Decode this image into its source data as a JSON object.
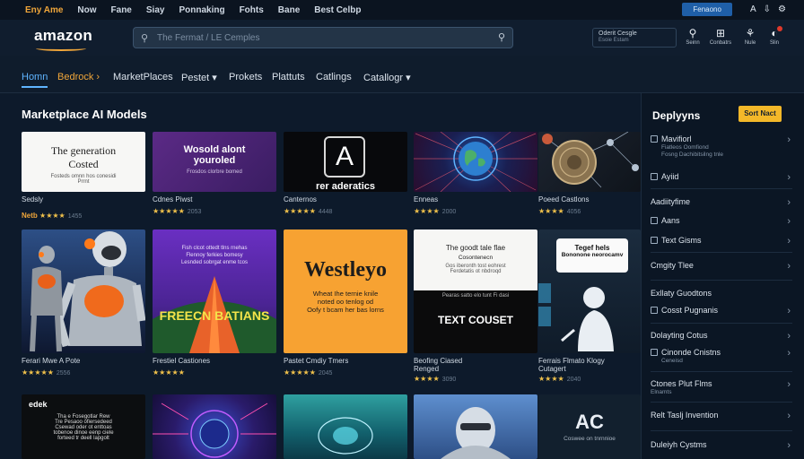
{
  "topbar": {
    "links": [
      "Eny Ame",
      "Now",
      "Fane",
      "Siay",
      "Ponnaking",
      "Fohts",
      "Bane",
      "Best Celbp"
    ],
    "pill": "Fenaono",
    "icons": [
      "A",
      "⇩",
      "⚙"
    ]
  },
  "header": {
    "logo": "amazon",
    "search_placeholder": "The Fermat / LE Cemples",
    "account_line1": "Oderit Cesgle",
    "account_line2": "Esoie Estam",
    "icons": [
      {
        "glyph": "⚲",
        "label": "Seinn"
      },
      {
        "glyph": "⊞",
        "label": "Conbatrs"
      },
      {
        "glyph": "⚘",
        "label": "Nule"
      },
      {
        "glyph": "◐",
        "label": "Slin"
      }
    ]
  },
  "nav": {
    "items": [
      "Homn",
      "Bedrock ›",
      "MarketPlaces",
      "Pestet ▾",
      "Prokets",
      "Plattuts",
      "Catlings",
      "Catallogr ▾"
    ]
  },
  "section_title": "Marketplace AI Models",
  "cards": {
    "c1": {
      "line1": "The generation",
      "line2": "Costed",
      "line3": "Fosteds omnn hos conesidi",
      "line4": "Prrnt",
      "caption": "Sedsly",
      "stars_lead": "Netb",
      "stars": "★★★★",
      "count": "1455"
    },
    "c2": {
      "line1": "Wosold alont",
      "line2": "youroled",
      "line3": "Frosdos clorbre bomed",
      "caption": "Cdnes Piwst",
      "stars": "★★★★★",
      "count": "2053"
    },
    "c3": {
      "glyph": "A",
      "line1": "rer aderatics",
      "caption": "Canternos",
      "stars": "★★★★★",
      "count": "4448"
    },
    "c4": {
      "caption": "Enneas",
      "stars": "★★★★",
      "count": "2000"
    },
    "c5": {
      "caption": "Poeed Castlons",
      "stars": "★★★★",
      "count": "4056"
    },
    "c6": {
      "caption": "Ferari Mwe A Pote",
      "stars": "★★★★★",
      "count": "2556"
    },
    "c7": {
      "line1": "Fish clcot ottedt tlns rnehas",
      "line2": "Flennoy ferkies bomesy",
      "line3": "Lesnded sobrgat enme tcos",
      "line4": "FREECN BATIANS",
      "caption": "Frestiel Castiones",
      "stars": "★★★★★",
      "count": ""
    },
    "c8": {
      "line1": "Westleyo",
      "line2": "Wheat Ihe ternie knile",
      "line3": "noted oo tenlog od",
      "line4": "Oofy t bcam her bas lorns",
      "caption": "Pastet Cmdiy Tmers",
      "stars": "★★★★★",
      "count": "2045"
    },
    "c9": {
      "line1": "The goodt tale flae",
      "line2": "Cosontenecn",
      "line3": "Gos iberonth tost eohrest",
      "line4": "Ferdetatis ot nbdroqd",
      "line5": "Pearas satto elo tunt Fi dasi",
      "line6": "TEXT COUSET",
      "caption": "Beofing Ciased",
      "caption2": "Renged",
      "stars": "★★★★",
      "count": "3090"
    },
    "c10": {
      "line1": "Tegef hels",
      "line2": "Bononone neorocamv",
      "caption": "Ferrais Flmato Klogy",
      "caption2": "Cutagert",
      "stars": "★★★★",
      "count": "2040"
    },
    "c11": {
      "line1": "edek",
      "line2": "Tha e Fosegotlar Rew",
      "line3": "Tre Pesaoo ofiersedeed",
      "line4": "Csewad oder ot enttoas",
      "line5": "tobenoe dinoe eenp ciele",
      "line6": "forteed tr deell lapgolt",
      "caption": "",
      "stars": "",
      "count": ""
    },
    "c12": {
      "caption": "",
      "stars": "",
      "count": ""
    },
    "c13": {
      "caption": "",
      "stars": "",
      "count": ""
    },
    "c14": {
      "caption": "",
      "stars": "",
      "count": ""
    },
    "c15": {
      "line1": "AC",
      "line2": "Coswee on tnrnnioe",
      "caption": "",
      "stars": "",
      "count": ""
    }
  },
  "panel": {
    "title": "Deplyyns",
    "button": "Sort Nact",
    "rows": [
      {
        "label": "Mavifiorl",
        "sub1": "Fiatleos Oomfiond",
        "sub2": "Fosng Dachibitsilng tnle"
      },
      {
        "label": "Ayiid"
      },
      {
        "label": "Aadiityfime"
      },
      {
        "label": "Aans"
      },
      {
        "label": "Text Gisms"
      },
      {
        "label": "Cmgity Tlee"
      },
      {
        "label": "Exllaty Guodtons"
      },
      {
        "label": "Cosst Pugnanis"
      },
      {
        "label": "Dolayting Cotus"
      },
      {
        "label": "Cinonde Cnistns",
        "sub1": "Ceneisd"
      },
      {
        "label": "Ctones Plut Flms",
        "sub1": "Elnamts"
      },
      {
        "label": "Relt Taslj Invention"
      },
      {
        "label": "Duleiyh Cystms"
      }
    ]
  }
}
